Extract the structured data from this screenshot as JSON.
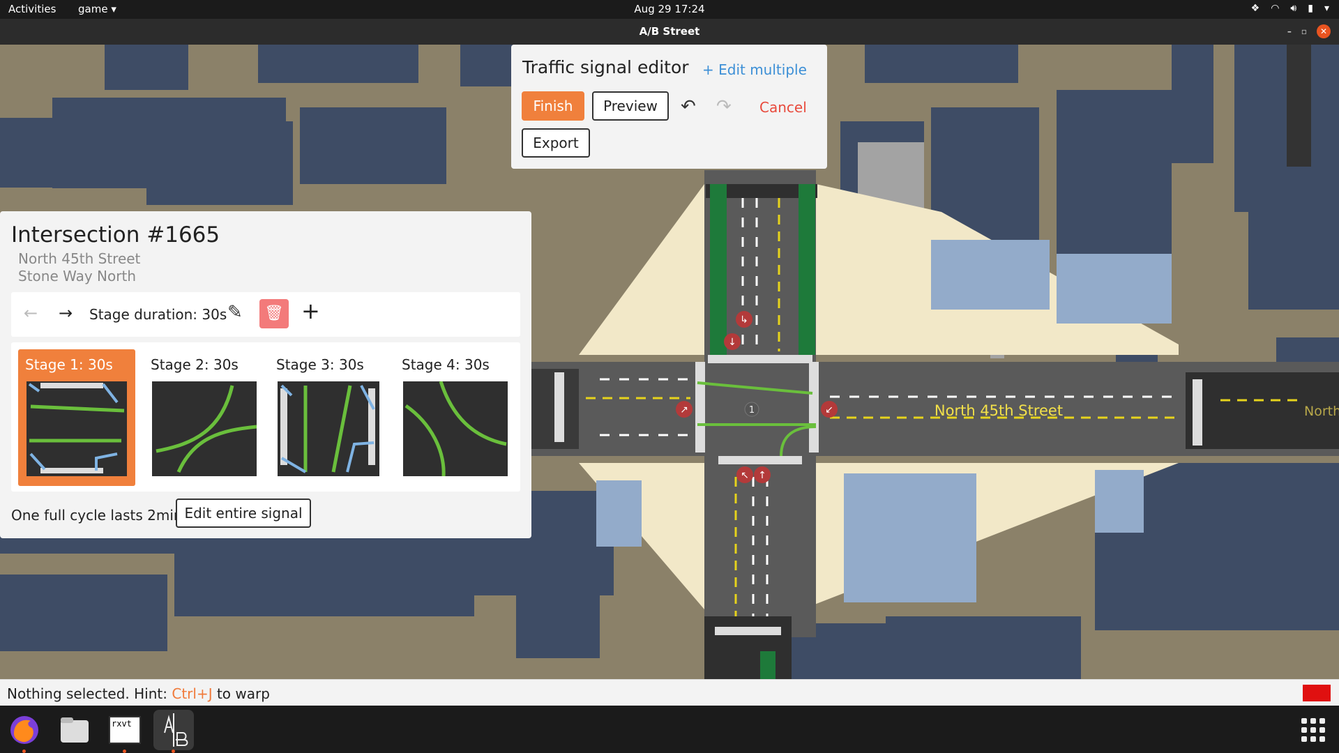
{
  "system": {
    "activities": "Activities",
    "app_name": "game",
    "clock": "Aug 29  17:24"
  },
  "window": {
    "title": "A/B Street"
  },
  "signal_editor": {
    "title": "Traffic signal editor",
    "edit_multiple": "+ Edit multiple",
    "finish": "Finish",
    "preview": "Preview",
    "cancel": "Cancel",
    "export": "Export"
  },
  "intersection": {
    "title": "Intersection #1665",
    "road1": "North 45th Street",
    "road2": "Stone Way North",
    "stage_duration": "Stage duration: 30s",
    "stages": [
      {
        "label": "Stage 1: 30s",
        "selected": true
      },
      {
        "label": "Stage 2: 30s",
        "selected": false
      },
      {
        "label": "Stage 3: 30s",
        "selected": false
      },
      {
        "label": "Stage 4: 30s",
        "selected": false
      }
    ],
    "cycle_text": "One full cycle lasts 2min",
    "edit_signal": "Edit entire signal"
  },
  "map": {
    "street_label": "North 45th Street",
    "street_label_right": "North",
    "intersection_badge": "1"
  },
  "status": {
    "prefix": "Nothing selected. Hint: ",
    "hotkey": "Ctrl+J",
    "suffix": " to warp"
  },
  "dock": {
    "terminal_label": "rxvt"
  },
  "colors": {
    "accent": "#f0803c",
    "link": "#3c8fd6",
    "danger": "#e84a3c",
    "route": "#6abf3c"
  }
}
